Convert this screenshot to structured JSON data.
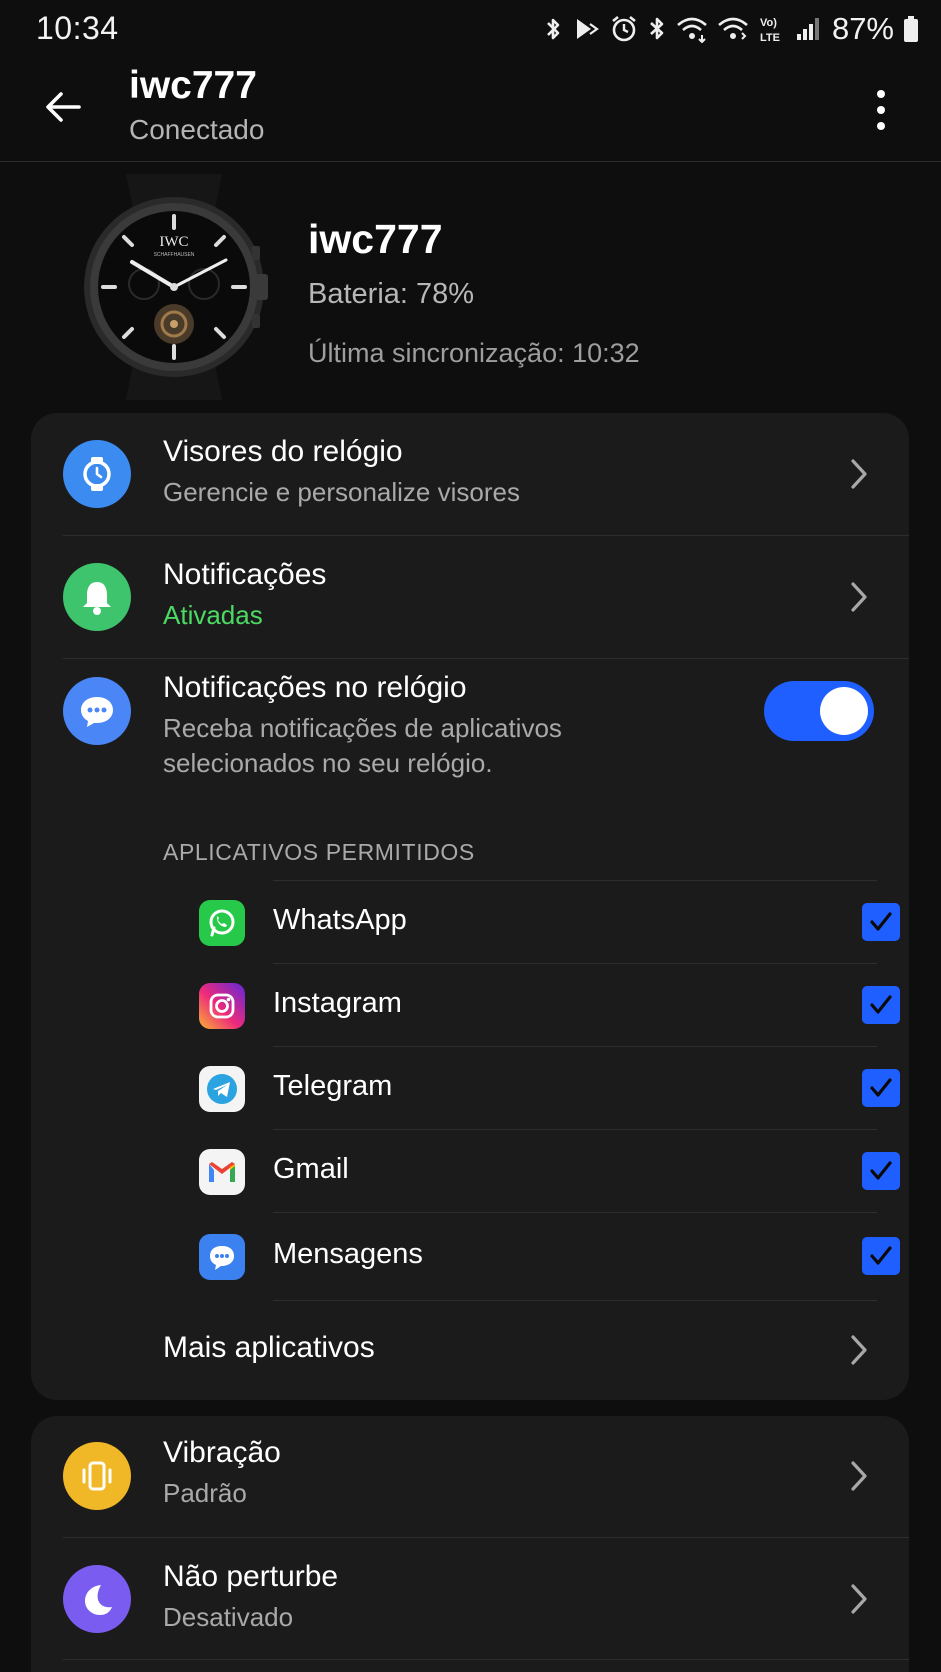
{
  "status_bar": {
    "time": "10:34",
    "battery": "87%"
  },
  "app_bar": {
    "title": "iwc777",
    "subtitle": "Conectado"
  },
  "device": {
    "name": "iwc777",
    "battery": "Bateria: 78%",
    "last_sync": "Última sincronização: 10:32",
    "watch_brand": "IWC",
    "watch_sub": "SCHAFFHAUSEN"
  },
  "settings": {
    "watch_faces": {
      "title": "Visores do relógio",
      "subtitle": "Gerencie e personalize visores"
    },
    "notifications": {
      "title": "Notificações",
      "subtitle": "Ativadas",
      "subtitle_color": "#4cd964"
    },
    "watch_notifications": {
      "title": "Notificações no relógio",
      "subtitle": "Receba notificações de aplicativos selecionados no seu relógio.",
      "enabled": true
    },
    "allowed_apps_header": "APLICATIVOS PERMITIDOS",
    "apps": [
      {
        "name": "WhatsApp",
        "icon": "whatsapp-icon",
        "checked": true
      },
      {
        "name": "Instagram",
        "icon": "instagram-icon",
        "checked": true
      },
      {
        "name": "Telegram",
        "icon": "telegram-icon",
        "checked": true
      },
      {
        "name": "Gmail",
        "icon": "gmail-icon",
        "checked": true
      },
      {
        "name": "Mensagens",
        "icon": "messages-icon",
        "checked": true
      }
    ],
    "more_apps": "Mais aplicativos",
    "vibration": {
      "title": "Vibração",
      "subtitle": "Padrão"
    },
    "dnd": {
      "title": "Não perturbe",
      "subtitle": "Desativado"
    }
  },
  "colors": {
    "accent": "#1f5eff",
    "watch_faces_icon": "#3b8bf0",
    "notifications_icon": "#3ec46d",
    "watch_notifications_icon": "#4a86f5",
    "vibration_icon": "#f0b726",
    "dnd_icon": "#7a5cf0"
  }
}
